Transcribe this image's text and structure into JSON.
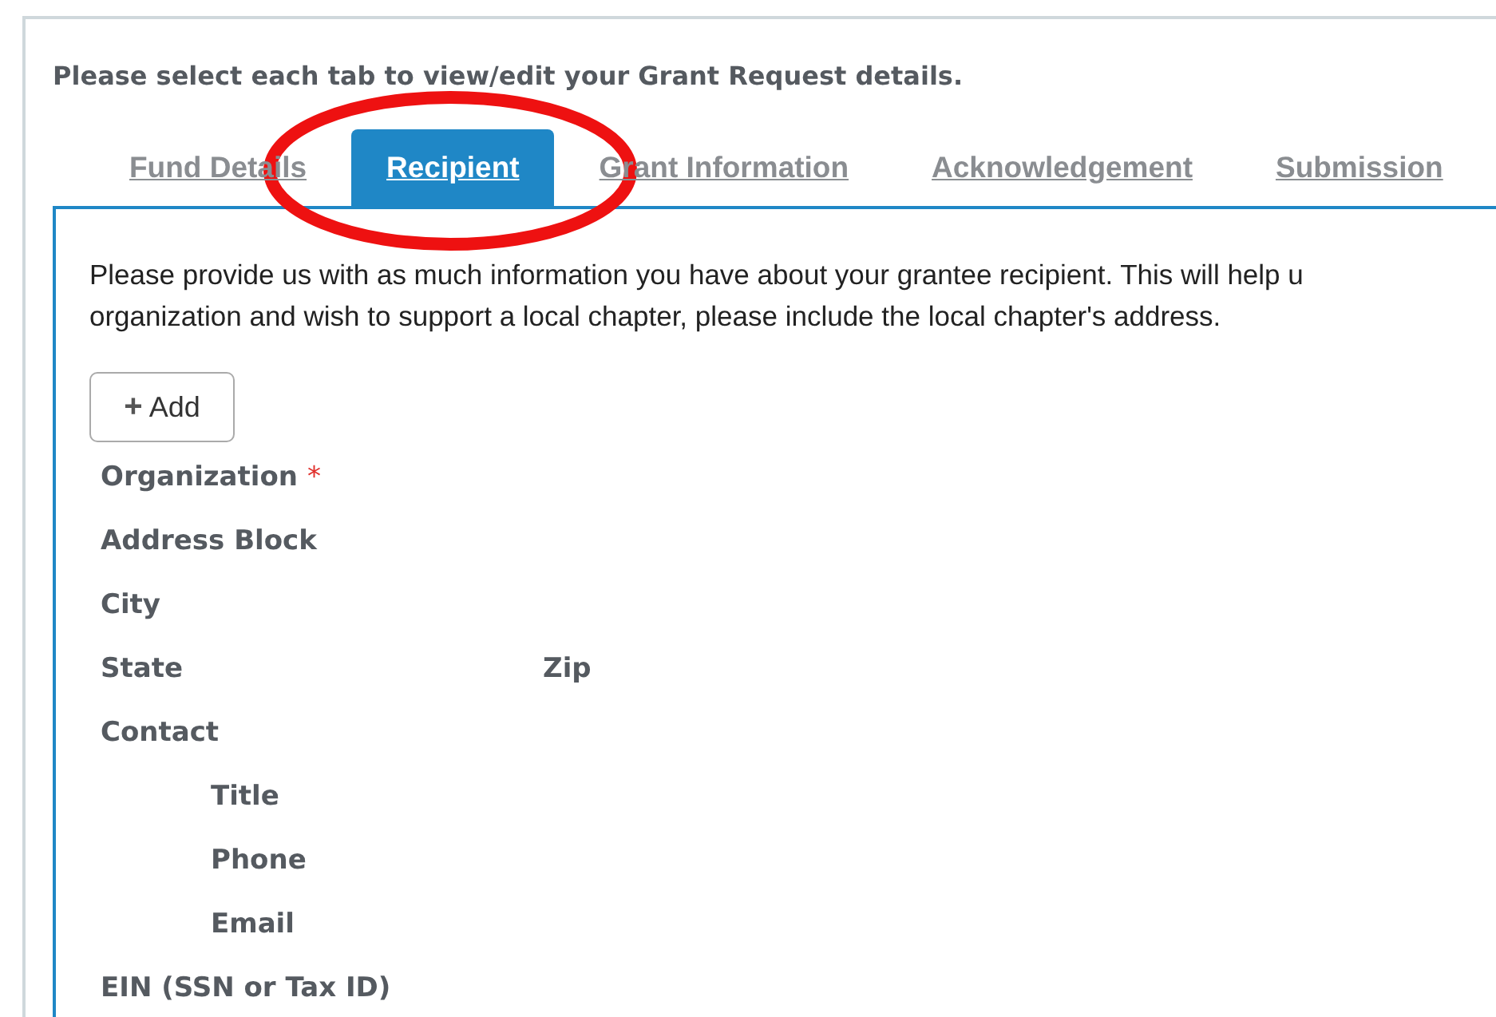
{
  "instructions": "Please select each tab to view/edit your Grant Request details.",
  "tabs": [
    {
      "label": "Fund Details",
      "selected": false
    },
    {
      "label": "Recipient",
      "selected": true
    },
    {
      "label": "Grant Information",
      "selected": false
    },
    {
      "label": "Acknowledgement",
      "selected": false
    },
    {
      "label": "Submission",
      "selected": false
    }
  ],
  "description_lines": [
    "Please provide us with as much information you have about your grantee recipient. This will help u",
    "organization and wish to support a local chapter, please include the local chapter's address."
  ],
  "add_button": {
    "icon": "+",
    "label": "Add"
  },
  "fields": [
    {
      "label": "Organization",
      "required": true,
      "marker": "*"
    },
    {
      "label": "Address Block",
      "required": false
    },
    {
      "label": "City",
      "required": false
    },
    {
      "label": "State",
      "required": false,
      "side_label": "Zip"
    },
    {
      "label": "Contact",
      "required": false,
      "children": [
        {
          "label": "Title",
          "required": false
        },
        {
          "label": "Phone",
          "required": false
        },
        {
          "label": "Email",
          "required": false
        }
      ]
    },
    {
      "label": "EIN (SSN or Tax ID)",
      "required": false
    }
  ]
}
